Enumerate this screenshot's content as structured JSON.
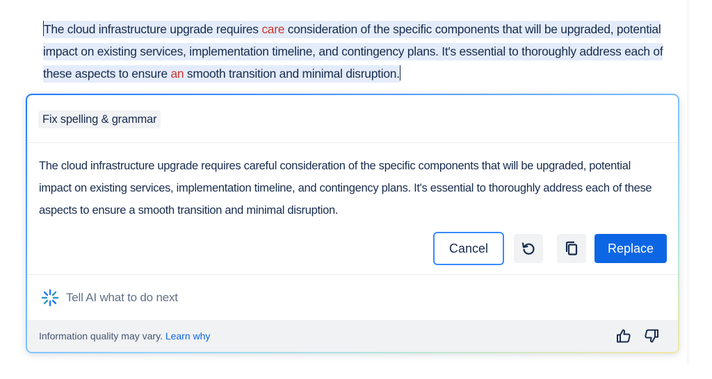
{
  "original": {
    "seg1": "The cloud infrastructure upgrade requires ",
    "err1": "care",
    "seg2": " consideration of the specific components that will be upgraded, potential impact on existing services, implementation timeline, and contingency plans. It's essential to thoroughly address each of these aspects to ensure ",
    "err2": "an",
    "seg3": " smooth transition and minimal disruption."
  },
  "panel": {
    "action_chip": "Fix spelling & grammar",
    "suggestion": "The cloud infrastructure upgrade requires careful consideration of the specific components that will be upgraded, potential impact on existing services, implementation timeline, and contingency plans. It's essential to thoroughly address each of these aspects to ensure a smooth transition and minimal disruption.",
    "cancel_label": "Cancel",
    "replace_label": "Replace",
    "retry_icon": "retry-icon",
    "copy_icon": "copy-icon",
    "prompt_placeholder": "Tell AI what to do next",
    "prompt_icon": "ai-sparkle-icon"
  },
  "footer": {
    "notice": "Information quality may vary.",
    "link": "Learn why",
    "thumbs_up_icon": "thumbs-up-icon",
    "thumbs_down_icon": "thumbs-down-icon"
  },
  "colors": {
    "accent": "#0c66e4",
    "error_text": "#c9372c",
    "selection": "#e4ecfb"
  }
}
